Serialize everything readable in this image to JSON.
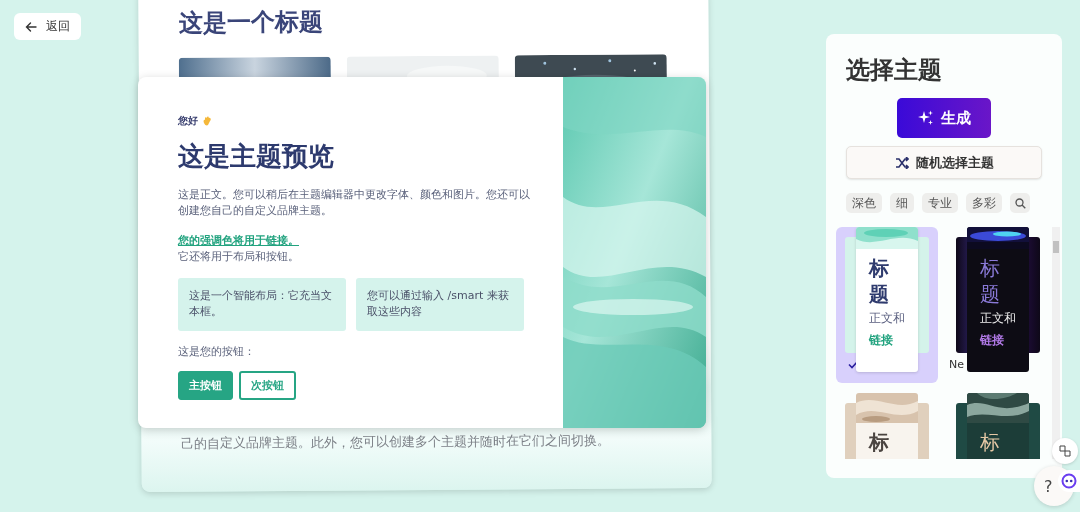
{
  "back_button": {
    "label": "返回"
  },
  "slide_behind": {
    "title": "这是一个标题",
    "body": "己的自定义品牌主题。此外，您可以创建多个主题并随时在它们之间切换。"
  },
  "preview": {
    "greeting": "您好",
    "title": "这是主题预览",
    "body": "这是正文。您可以稍后在主题编辑器中更改字体、颜色和图片。您还可以创建您自己的自定义品牌主题。",
    "link": "您的强调色将用于链接。",
    "link_note": "它还将用于布局和按钮。",
    "boxes": [
      "这是一个智能布局：它充当文本框。",
      "您可以通过输入 /smart 来获取这些内容"
    ],
    "buttons_label": "这是您的按钮：",
    "buttons": [
      {
        "kind": "primary",
        "label": "主按钮"
      },
      {
        "kind": "secondary",
        "label": "次按钮"
      }
    ]
  },
  "theme_panel": {
    "title": "选择主题",
    "generate_button": "生成",
    "random_button": "随机选择主题",
    "filters": [
      "深色",
      "细",
      "专业",
      "多彩"
    ],
    "themes": [
      {
        "kind": "mint",
        "selected": true,
        "heading": "标题",
        "body": "正文和",
        "link": "链接"
      },
      {
        "kind": "nebula",
        "selected": false,
        "name": "Ne",
        "heading": "标题",
        "body": "正文和",
        "link": "链接"
      },
      {
        "kind": "sand",
        "selected": false,
        "heading": "标"
      },
      {
        "kind": "forest",
        "selected": false,
        "heading": "标"
      }
    ]
  },
  "help_button": "?"
}
